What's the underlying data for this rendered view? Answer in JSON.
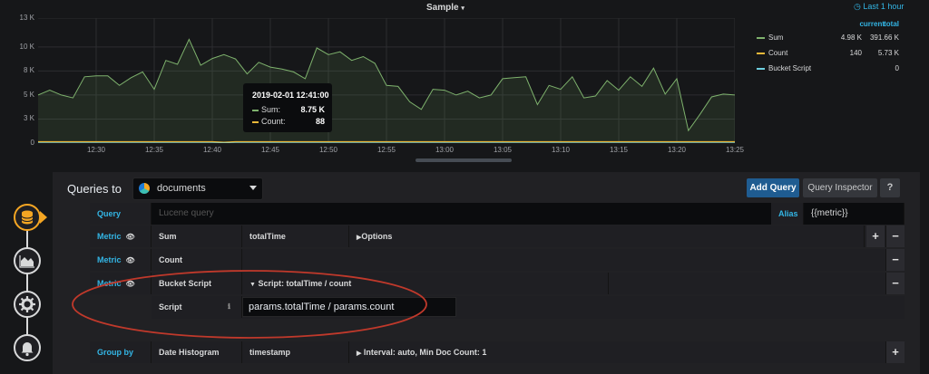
{
  "panel": {
    "title": "Sample",
    "time_range": "Last 1 hour",
    "y_ticks": [
      "13 K",
      "10 K",
      "8 K",
      "5 K",
      "3 K",
      "0"
    ],
    "x_ticks": [
      "12:30",
      "12:35",
      "12:40",
      "12:45",
      "12:50",
      "12:55",
      "13:00",
      "13:05",
      "13:10",
      "13:15",
      "13:20",
      "13:25"
    ],
    "legend": {
      "header_current": "current",
      "header_total": "total",
      "items": [
        {
          "name": "Sum",
          "current": "4.98 K",
          "total": "391.66 K",
          "color": "#7eb26d"
        },
        {
          "name": "Count",
          "current": "140",
          "total": "5.73 K",
          "color": "#eab839"
        },
        {
          "name": "Bucket Script",
          "current": "",
          "total": "0",
          "color": "#6ed0e0"
        }
      ]
    },
    "tooltip": {
      "title": "2019-02-01 12:41:00",
      "rows": [
        {
          "label": "Sum:",
          "value": "8.75 K",
          "color": "#7eb26d"
        },
        {
          "label": "Count:",
          "value": "88",
          "color": "#eab839"
        }
      ]
    }
  },
  "chart_data": {
    "type": "area",
    "ylim": [
      0,
      13000
    ],
    "x": [
      "12:25",
      "12:26",
      "12:27",
      "12:28",
      "12:29",
      "12:30",
      "12:31",
      "12:32",
      "12:33",
      "12:34",
      "12:35",
      "12:36",
      "12:37",
      "12:38",
      "12:39",
      "12:40",
      "12:41",
      "12:42",
      "12:43",
      "12:44",
      "12:45",
      "12:46",
      "12:47",
      "12:48",
      "12:49",
      "12:50",
      "12:51",
      "12:52",
      "12:53",
      "12:54",
      "12:55",
      "12:56",
      "12:57",
      "12:58",
      "12:59",
      "13:00",
      "13:01",
      "13:02",
      "13:03",
      "13:04",
      "13:05",
      "13:06",
      "13:07",
      "13:08",
      "13:09",
      "13:10",
      "13:11",
      "13:12",
      "13:13",
      "13:14",
      "13:15",
      "13:16",
      "13:17",
      "13:18",
      "13:19",
      "13:20",
      "13:21",
      "13:22",
      "13:23",
      "13:24",
      "13:25"
    ],
    "series": [
      {
        "name": "Sum",
        "color": "#7eb26d",
        "values": [
          5000,
          5500,
          5000,
          4700,
          6900,
          7000,
          7000,
          6000,
          6800,
          7400,
          5600,
          8600,
          8200,
          10800,
          8100,
          8800,
          9200,
          8750,
          7200,
          8400,
          7900,
          7700,
          7400,
          6700,
          9900,
          9200,
          9500,
          8600,
          9000,
          8300,
          6000,
          5900,
          4300,
          3500,
          5600,
          5500,
          5000,
          5400,
          4700,
          5000,
          6700,
          6800,
          6900,
          4000,
          6000,
          5600,
          6900,
          4700,
          4900,
          6500,
          5500,
          6900,
          5900,
          7800,
          5100,
          6700,
          1300,
          3000,
          4800,
          5100,
          5000
        ]
      },
      {
        "name": "Count",
        "color": "#eab839",
        "values": [
          140,
          140,
          140,
          140,
          140,
          140,
          140,
          140,
          140,
          140,
          140,
          140,
          140,
          140,
          140,
          140,
          88,
          140,
          140,
          140,
          140,
          140,
          140,
          140,
          140,
          140,
          140,
          140,
          140,
          140,
          140,
          140,
          140,
          140,
          140,
          140,
          140,
          140,
          140,
          140,
          140,
          140,
          140,
          140,
          140,
          140,
          140,
          140,
          140,
          140,
          140,
          140,
          140,
          140,
          140,
          140,
          140,
          140,
          140,
          140,
          140
        ]
      },
      {
        "name": "Bucket Script",
        "color": "#6ed0e0",
        "values": [
          0,
          0,
          0,
          0,
          0,
          0,
          0,
          0,
          0,
          0,
          0,
          0,
          0,
          0,
          0,
          0,
          0,
          0,
          0,
          0,
          0,
          0,
          0,
          0,
          0,
          0,
          0,
          0,
          0,
          0,
          0,
          0,
          0,
          0,
          0,
          0,
          0,
          0,
          0,
          0,
          0,
          0,
          0,
          0,
          0,
          0,
          0,
          0,
          0,
          0,
          0,
          0,
          0,
          0,
          0,
          0,
          0,
          0,
          0,
          0,
          0
        ]
      }
    ]
  },
  "editor": {
    "queries_to": "Queries to",
    "datasource": "documents",
    "add_query": "Add Query",
    "query_inspector": "Query Inspector",
    "help": "?",
    "query_label": "Query",
    "query_placeholder": "Lucene query",
    "alias_label": "Alias",
    "alias_value": "{{metric}}",
    "metrics": [
      {
        "label": "Metric",
        "type": "Sum",
        "field": "totalTime",
        "options": "Options"
      },
      {
        "label": "Metric",
        "type": "Count"
      },
      {
        "label": "Metric",
        "type": "Bucket Script",
        "options": "Script: totalTime / count"
      }
    ],
    "script_label": "Script",
    "script_value": "params.totalTime / params.count",
    "group_by_label": "Group by",
    "group_by_type": "Date Histogram",
    "group_by_field": "timestamp",
    "group_by_options": "Interval: auto, Min Doc Count: 1",
    "plus": "+",
    "minus": "−"
  }
}
